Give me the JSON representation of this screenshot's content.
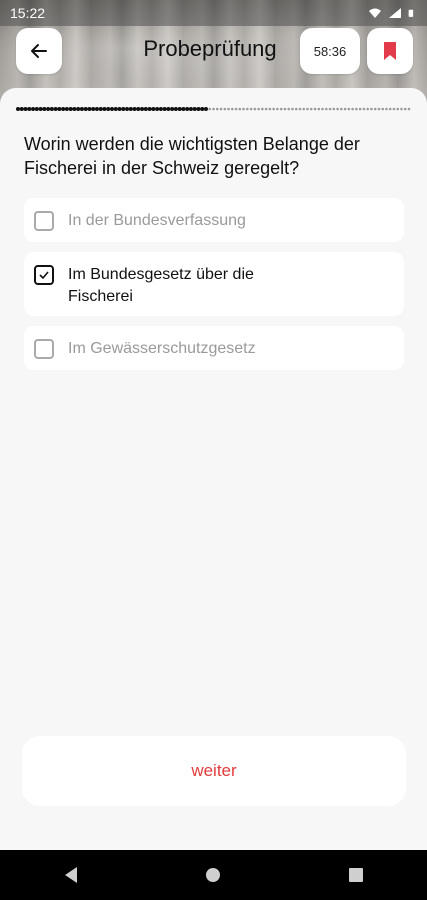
{
  "status_bar": {
    "time": "15:22",
    "icons": [
      "wifi-icon",
      "signal-icon",
      "battery-icon"
    ]
  },
  "header": {
    "title": "Probeprüfung",
    "timer": "58:36",
    "back_icon": "arrow-left-icon",
    "bookmark_icon": "bookmark-icon",
    "bookmark_color": "#e23c4a"
  },
  "progress": {
    "total": 35,
    "current_index": 17,
    "done_color": "#111111",
    "pending_color": "#9a9a9a"
  },
  "question": {
    "text": "Worin werden die wichtigsten Belange der Fischerei in der Schweiz geregelt?"
  },
  "options": [
    {
      "label": "In der Bundesverfassung",
      "checked": false
    },
    {
      "label": "Im Bundesgesetz über die Fischerei",
      "checked": true
    },
    {
      "label": "Im Gewässerschutzgesetz",
      "checked": false
    }
  ],
  "footer": {
    "next_label": "weiter",
    "next_color": "#e23c3c"
  },
  "nav": {
    "icons": [
      "back-triangle-icon",
      "home-circle-icon",
      "recents-square-icon"
    ]
  }
}
